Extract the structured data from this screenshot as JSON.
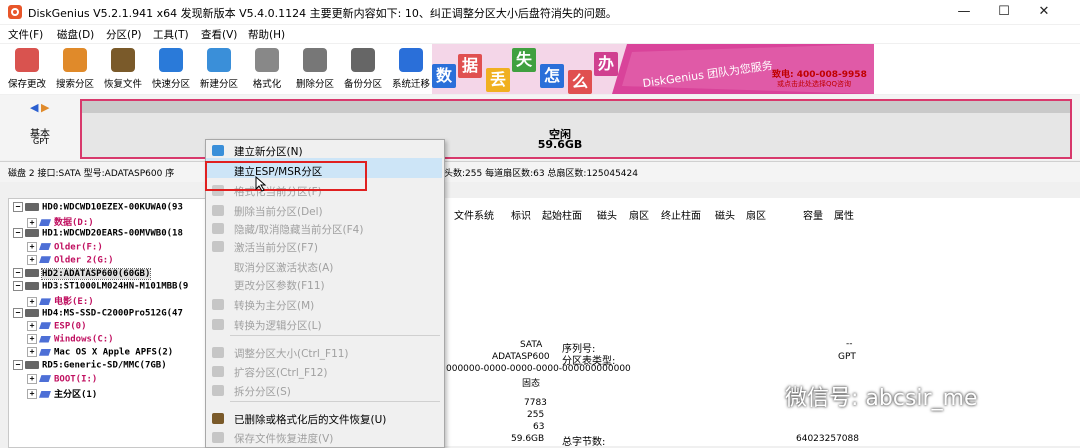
{
  "window": {
    "title": "DiskGenius V5.2.1.941 x64  发现新版本 V5.4.0.1124 主要更新内容如下: 10、纠正调整分区大小后盘符消失的问题。",
    "minimize": "—",
    "maximize": "☐",
    "close": "✕"
  },
  "menu": [
    "文件(F)",
    "磁盘(D)",
    "分区(P)",
    "工具(T)",
    "查看(V)",
    "帮助(H)"
  ],
  "toolbar": [
    {
      "label": "保存更改",
      "icon": "save-icon",
      "color": "#d9534f"
    },
    {
      "label": "搜索分区",
      "icon": "search-icon",
      "color": "#e08a2a"
    },
    {
      "label": "恢复文件",
      "icon": "recover-icon",
      "color": "#7a5a2a"
    },
    {
      "label": "快速分区",
      "icon": "quick-partition-icon",
      "color": "#2a7ad9"
    },
    {
      "label": "新建分区",
      "icon": "new-partition-icon",
      "color": "#3a8fd9"
    },
    {
      "label": "格式化",
      "icon": "format-icon",
      "color": "#888888"
    },
    {
      "label": "删除分区",
      "icon": "delete-icon",
      "color": "#777777"
    },
    {
      "label": "备份分区",
      "icon": "backup-icon",
      "color": "#666666"
    },
    {
      "label": "系统迁移",
      "icon": "migrate-icon",
      "color": "#2a6fd9"
    }
  ],
  "banner": {
    "chars": [
      "数",
      "据",
      "丢",
      "失",
      "怎",
      "么",
      "办"
    ],
    "brand": "DiskGenius 团队为您服务",
    "phone": "致电: 400-008-9958",
    "qq": "或点击此处选择QQ咨询"
  },
  "disk_map": {
    "basic": "基本",
    "scheme": "GPT",
    "partition_label": "空闲",
    "partition_size": "59.6GB"
  },
  "info_left": "磁盘 2 接口:SATA  型号:ADATASP600  序",
  "info_right": "头数:255  每道扇区数:63  总扇区数:125045424",
  "tree": [
    {
      "text": "HD0:WDCWD10EZEX-00KUWA0(93",
      "level": 0,
      "type": "disk"
    },
    {
      "text": "数据(D:)",
      "level": 1,
      "type": "part",
      "color": "#c01060"
    },
    {
      "text": "HD1:WDCWD20EARS-00MVWB0(18",
      "level": 0,
      "type": "disk"
    },
    {
      "text": "Older(F:)",
      "level": 1,
      "type": "part",
      "color": "#c01060"
    },
    {
      "text": "Older 2(G:)",
      "level": 1,
      "type": "part",
      "color": "#c01060"
    },
    {
      "text": "HD2:ADATASP600(60GB)",
      "level": 0,
      "type": "disk",
      "selected": true
    },
    {
      "text": "HD3:ST1000LM024HN-M101MBB(9",
      "level": 0,
      "type": "disk"
    },
    {
      "text": "电影(E:)",
      "level": 1,
      "type": "part",
      "color": "#c01060"
    },
    {
      "text": "HD4:MS-SSD-C2000Pro512G(47",
      "level": 0,
      "type": "disk"
    },
    {
      "text": "ESP(0)",
      "level": 1,
      "type": "part",
      "color": "#c01060"
    },
    {
      "text": "Windows(C:)",
      "level": 1,
      "type": "part",
      "color": "#c01060"
    },
    {
      "text": "Mac OS X Apple APFS(2)",
      "level": 1,
      "type": "part",
      "color": "#000000"
    },
    {
      "text": "RD5:Generic-SD/MMC(7GB)",
      "level": 0,
      "type": "disk"
    },
    {
      "text": "BOOT(I:)",
      "level": 1,
      "type": "part",
      "color": "#c01060"
    },
    {
      "text": "主分区(1)",
      "level": 1,
      "type": "part",
      "color": "#000000"
    }
  ],
  "columns": [
    "文件系统",
    "标识",
    "起始柱面",
    "磁头",
    "扇区",
    "终止柱面",
    "磁头",
    "扇区",
    "容量",
    "属性"
  ],
  "details": {
    "iface": "SATA",
    "model": "ADATASP600",
    "guid": "000000-0000-0000-0000-000000000000",
    "fixed": "固态",
    "serial_label": "序列号:",
    "serial_value": "--",
    "pt_label": "分区表类型:",
    "pt_value": "GPT",
    "cyl": "7783",
    "heads": "255",
    "spt": "63",
    "cap": "59.6GB",
    "bytes_label": "总字节数:",
    "bytes_value": "64023257088"
  },
  "context_menu": [
    {
      "label": "建立新分区(N)",
      "enabled": true,
      "icon": "new-partition-icon",
      "color": "#3a8fd9"
    },
    {
      "label": "建立ESP/MSR分区",
      "enabled": true,
      "highlighted": true,
      "icon": "",
      "color": ""
    },
    {
      "label": "格式化当前分区(F)",
      "enabled": false,
      "icon": "format-icon",
      "color": "#888888"
    },
    {
      "label": "删除当前分区(Del)",
      "enabled": false,
      "icon": "delete-icon",
      "color": "#777777"
    },
    {
      "label": "隐藏/取消隐藏当前分区(F4)",
      "enabled": false,
      "icon": "hide-icon",
      "color": "#777777"
    },
    {
      "label": "激活当前分区(F7)",
      "enabled": false,
      "icon": "activate-icon",
      "color": "#777777"
    },
    {
      "label": "取消分区激活状态(A)",
      "enabled": false,
      "icon": "",
      "color": ""
    },
    {
      "label": "更改分区参数(F11)",
      "enabled": false,
      "icon": "",
      "color": ""
    },
    {
      "label": "转换为主分区(M)",
      "enabled": false,
      "icon": "convert-icon",
      "color": "#777777"
    },
    {
      "label": "转换为逻辑分区(L)",
      "enabled": false,
      "icon": "convert-icon",
      "color": "#777777"
    },
    {
      "label": "调整分区大小(Ctrl_F11)",
      "enabled": false,
      "icon": "resize-icon",
      "color": "#777777"
    },
    {
      "label": "扩容分区(Ctrl_F12)",
      "enabled": false,
      "icon": "extend-icon",
      "color": "#777777"
    },
    {
      "label": "拆分分区(S)",
      "enabled": false,
      "icon": "split-icon",
      "color": "#777777"
    },
    {
      "label": "已删除或格式化后的文件恢复(U)",
      "enabled": true,
      "icon": "recover-icon",
      "color": "#7a5a2a"
    },
    {
      "label": "保存文件恢复进度(V)",
      "enabled": false,
      "icon": "save-progress-icon",
      "color": "#777777"
    }
  ],
  "watermark": "微信号: abcsir_me"
}
